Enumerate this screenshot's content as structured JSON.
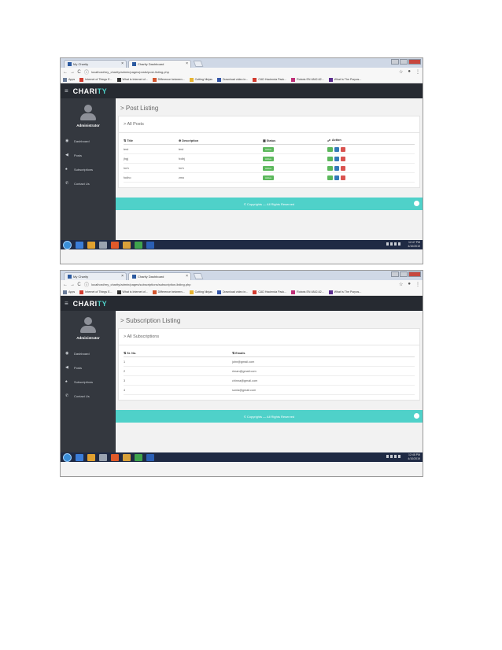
{
  "browser": {
    "tabs": [
      {
        "label": "My Charity"
      },
      {
        "label": "Charity Dashboard"
      }
    ],
    "bookmarks": [
      {
        "label": "Apps",
        "color": "#6b7d99"
      },
      {
        "label": "Internet of Things E...",
        "color": "#d23b2f"
      },
      {
        "label": "What is Internet of...",
        "color": "#333333"
      },
      {
        "label": "Difference between...",
        "color": "#d2562f"
      },
      {
        "label": "Cutting Ninjas",
        "color": "#e7b431"
      },
      {
        "label": "Download video in...",
        "color": "#3456a8"
      },
      {
        "label": "CAD Hacienda Pack...",
        "color": "#d23b2f"
      },
      {
        "label": "Robots EN 4842-62...",
        "color": "#c02f77"
      },
      {
        "label": "What Is The Purpos...",
        "color": "#5b2d8e"
      }
    ]
  },
  "app": {
    "logo_main": "CHARI",
    "logo_accent": "TY",
    "admin_name": "Administrator",
    "menu": [
      {
        "label": "Dashboard",
        "icon": "dashboard-icon",
        "glyph": "◉"
      },
      {
        "label": "Posts",
        "icon": "send-icon",
        "glyph": "◀"
      },
      {
        "label": "Subscriptions",
        "icon": "bell-icon",
        "glyph": "♠"
      },
      {
        "label": "Contact Us",
        "icon": "phone-icon",
        "glyph": "✆"
      }
    ],
    "footer": "© Copyrights — All Rights Reserved"
  },
  "screen1": {
    "url": "localhost/my_charity/admin/pages/posts/post-listing.php",
    "page_title": "Post Listing",
    "panel_title": "All Posts",
    "columns": {
      "title": "Title",
      "description": "Description",
      "status": "Status",
      "action": "Action"
    },
    "rows": [
      {
        "title": "test",
        "description": "test",
        "status": "Active"
      },
      {
        "title": "jhgj",
        "description": "fcdhj",
        "status": "Active"
      },
      {
        "title": "hrrh",
        "description": "hrrh",
        "status": "Active"
      },
      {
        "title": "fodho",
        "description": "zmo",
        "status": "Active"
      }
    ],
    "clock": {
      "time": "12:47 PM",
      "date": "4/10/2019"
    }
  },
  "screen2": {
    "url": "localhost/my_charity/admin/pages/subscriptions/subscription-listing.php",
    "page_title": "Subscription Listing",
    "panel_title": "All Subscriptions",
    "columns": {
      "srno": "Sr. No.",
      "emails": "Emails"
    },
    "rows": [
      {
        "srno": "1",
        "email": "john@gmail.com"
      },
      {
        "srno": "2",
        "email": "riman@gmail.com"
      },
      {
        "srno": "3",
        "email": "chinna@gmail.com"
      },
      {
        "srno": "4",
        "email": "sonia@gmail.com"
      }
    ],
    "clock": {
      "time": "12:48 PM",
      "date": "4/10/2019"
    }
  }
}
